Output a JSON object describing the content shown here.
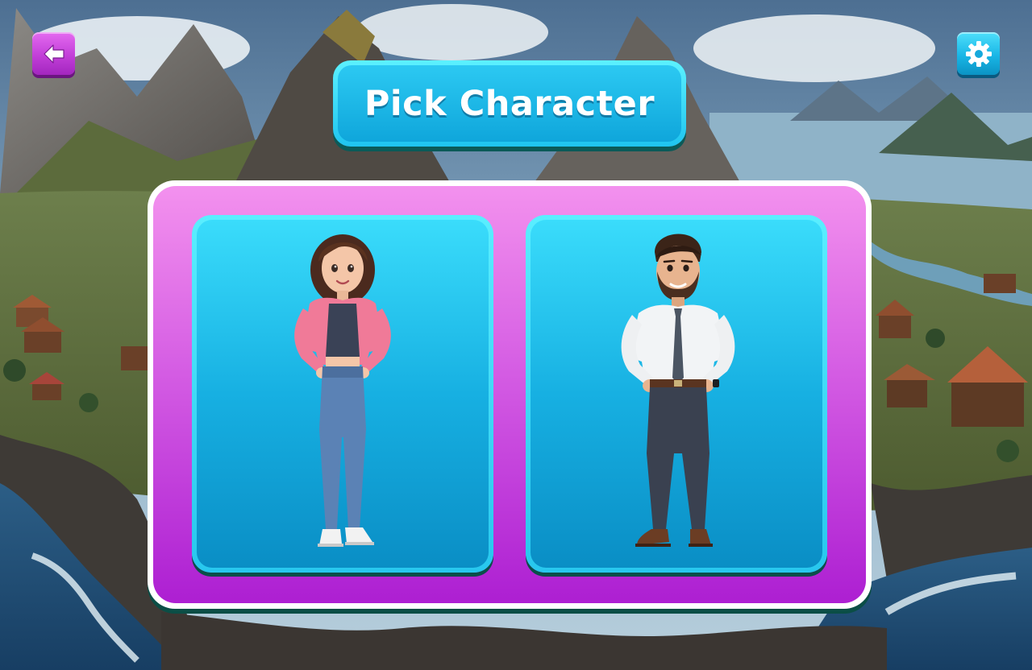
{
  "screen": {
    "title": "Pick Character"
  },
  "top_bar": {
    "back_button_icon": "arrow-left-icon",
    "settings_button_icon": "gear-icon"
  },
  "characters": [
    {
      "id": "female",
      "icon": "female-character-avatar"
    },
    {
      "id": "male",
      "icon": "male-character-avatar"
    }
  ],
  "colors": {
    "back_button": "#c23fd8",
    "settings_button": "#19b6e6",
    "title_banner": "#1fb8ea",
    "panel": "#c83ddb",
    "card": "#17b0e2"
  }
}
